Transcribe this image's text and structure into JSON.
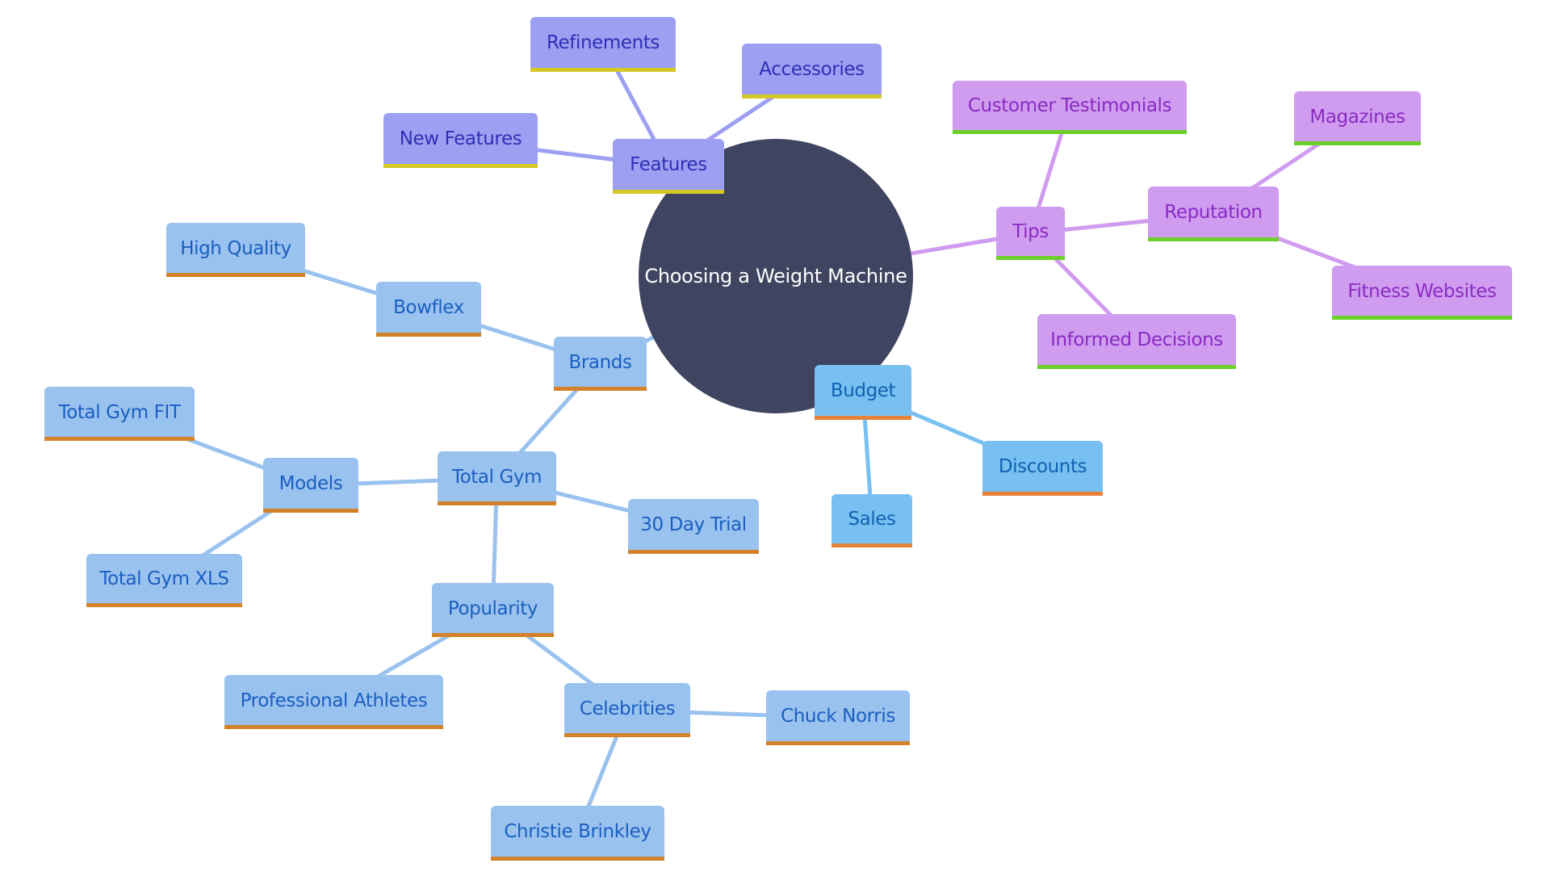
{
  "diagram": {
    "type": "mindmap",
    "root": {
      "id": "root",
      "label": "Choosing a Weight Machine"
    },
    "colors": {
      "root_fill": "#3f4560",
      "features": {
        "fill": "#9da0f2",
        "text": "#2f2fb5",
        "accent": "#d6c826",
        "edge": "#9da0f2"
      },
      "tips": {
        "fill": "#cf9cf0",
        "text": "#8a2bc2",
        "accent": "#6ccf2c",
        "edge": "#cf9cf0"
      },
      "budget": {
        "fill": "#78c0f2",
        "text": "#0f62b0",
        "accent": "#e6823a",
        "edge": "#78c0f2"
      },
      "brands": {
        "fill": "#9ac2ef",
        "text": "#1a5fc0",
        "accent": "#d4822a",
        "edge": "#9ac2ef"
      }
    },
    "nodes": {
      "features": {
        "label": "Features",
        "branch": "features",
        "parent": "root"
      },
      "refinements": {
        "label": "Refinements",
        "branch": "features",
        "parent": "features"
      },
      "accessories": {
        "label": "Accessories",
        "branch": "features",
        "parent": "features"
      },
      "new_features": {
        "label": "New Features",
        "branch": "features",
        "parent": "features"
      },
      "tips": {
        "label": "Tips",
        "branch": "tips",
        "parent": "root"
      },
      "customer_testimonials": {
        "label": "Customer Testimonials",
        "branch": "tips",
        "parent": "tips"
      },
      "reputation": {
        "label": "Reputation",
        "branch": "tips",
        "parent": "tips"
      },
      "magazines": {
        "label": "Magazines",
        "branch": "tips",
        "parent": "reputation"
      },
      "fitness_websites": {
        "label": "Fitness Websites",
        "branch": "tips",
        "parent": "reputation"
      },
      "informed_decisions": {
        "label": "Informed Decisions",
        "branch": "tips",
        "parent": "tips"
      },
      "budget": {
        "label": "Budget",
        "branch": "budget",
        "parent": "root"
      },
      "sales": {
        "label": "Sales",
        "branch": "budget",
        "parent": "budget"
      },
      "discounts": {
        "label": "Discounts",
        "branch": "budget",
        "parent": "budget"
      },
      "brands": {
        "label": "Brands",
        "branch": "brands",
        "parent": "root"
      },
      "bowflex": {
        "label": "Bowflex",
        "branch": "brands",
        "parent": "brands"
      },
      "high_quality": {
        "label": "High Quality",
        "branch": "brands",
        "parent": "bowflex"
      },
      "total_gym": {
        "label": "Total Gym",
        "branch": "brands",
        "parent": "brands"
      },
      "models": {
        "label": "Models",
        "branch": "brands",
        "parent": "total_gym"
      },
      "total_gym_fit": {
        "label": "Total Gym FIT",
        "branch": "brands",
        "parent": "models"
      },
      "total_gym_xls": {
        "label": "Total Gym XLS",
        "branch": "brands",
        "parent": "models"
      },
      "thirty_day_trial": {
        "label": "30 Day Trial",
        "branch": "brands",
        "parent": "total_gym"
      },
      "popularity": {
        "label": "Popularity",
        "branch": "brands",
        "parent": "total_gym"
      },
      "professional_athletes": {
        "label": "Professional Athletes",
        "branch": "brands",
        "parent": "popularity"
      },
      "celebrities": {
        "label": "Celebrities",
        "branch": "brands",
        "parent": "popularity"
      },
      "chuck_norris": {
        "label": "Chuck Norris",
        "branch": "brands",
        "parent": "celebrities"
      },
      "christie_brinkley": {
        "label": "Christie Brinkley",
        "branch": "brands",
        "parent": "celebrities"
      }
    }
  }
}
